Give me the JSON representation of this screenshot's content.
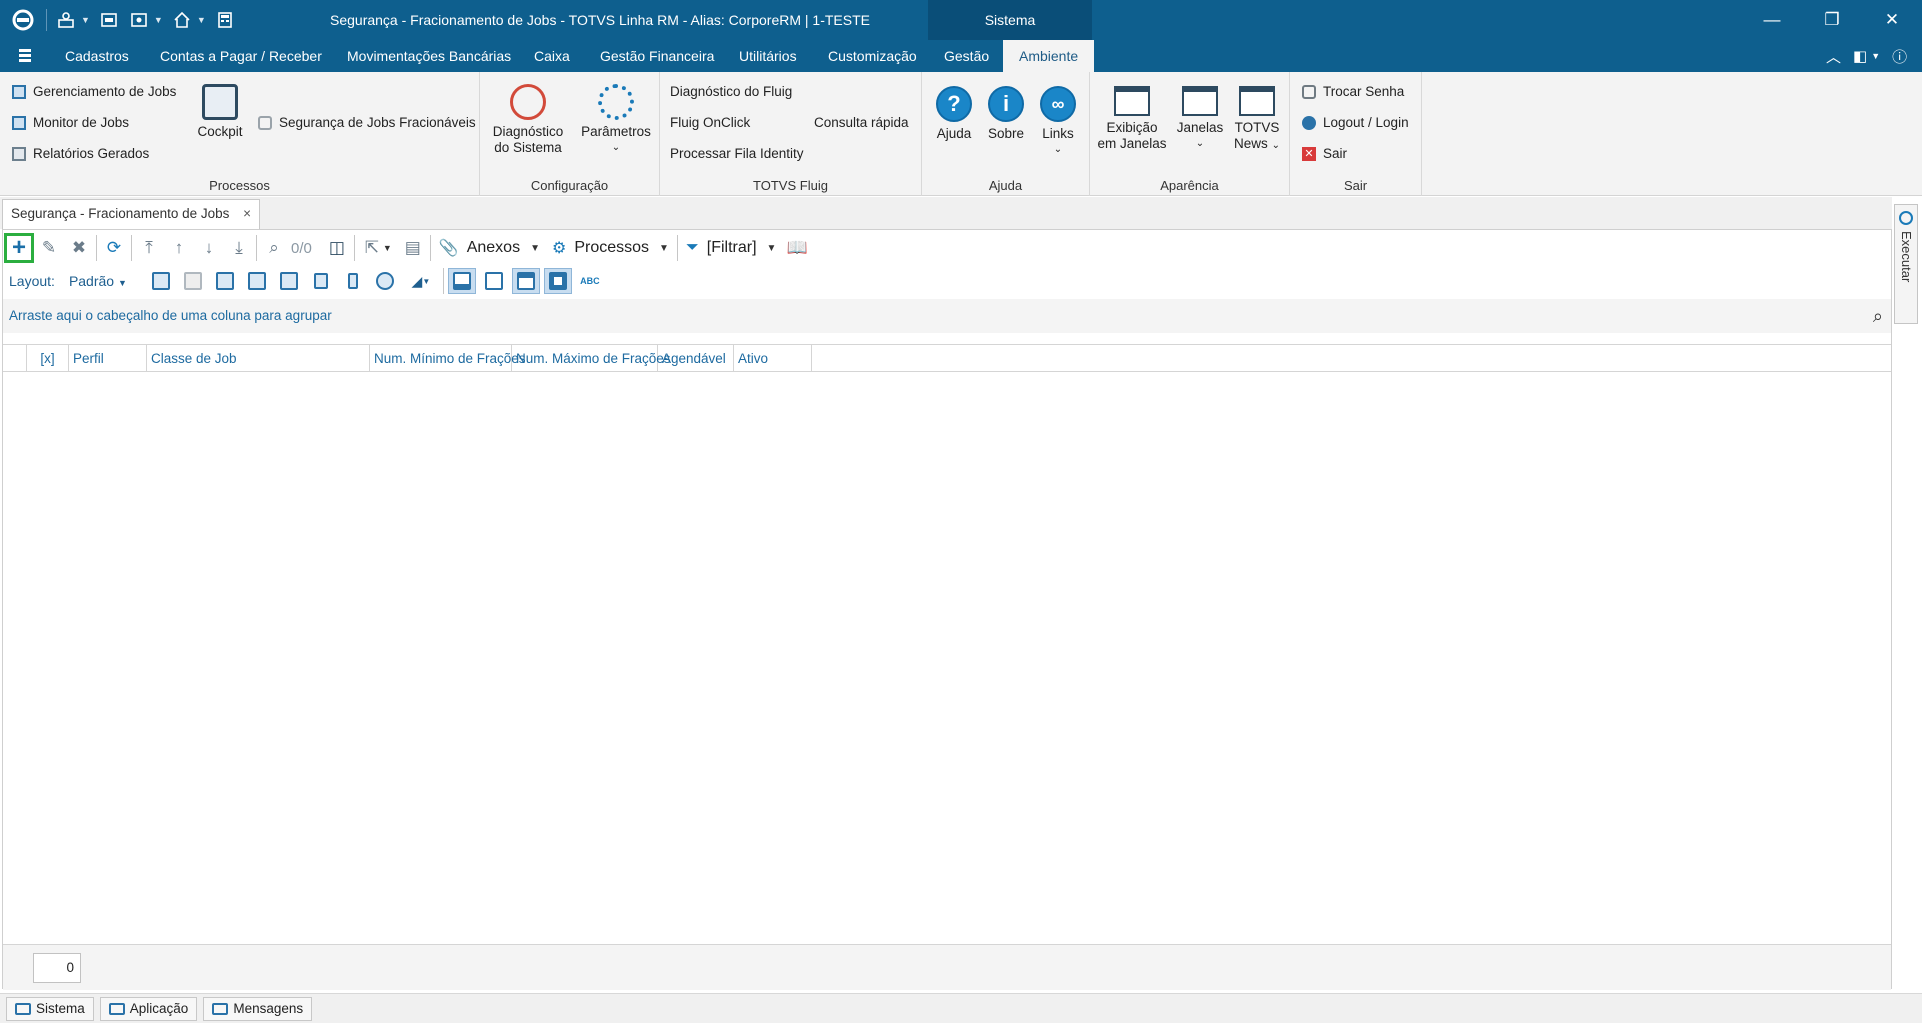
{
  "window": {
    "title": "Segurança - Fracionamento de Jobs - TOTVS Linha RM - Alias: CorporeRM | 1-TESTE",
    "context_tab": "Sistema",
    "minimize": "—",
    "restore": "❐",
    "close": "✕"
  },
  "menu": {
    "items": [
      "Cadastros",
      "Contas a Pagar / Receber",
      "Movimentações Bancárias",
      "Caixa",
      "Gestão Financeira",
      "Utilitários",
      "Customização",
      "Gestão",
      "Ambiente"
    ],
    "active": "Ambiente"
  },
  "ribbon": {
    "processos": {
      "label": "Processos",
      "items": [
        "Gerenciamento de Jobs",
        "Monitor de Jobs",
        "Relatórios Gerados"
      ],
      "cockpit": "Cockpit",
      "seguranca": "Segurança de Jobs Fracionáveis"
    },
    "configuracao": {
      "label": "Configuração",
      "diag_line1": "Diagnóstico",
      "diag_line2": "do Sistema",
      "parametros": "Parâmetros"
    },
    "fluig": {
      "label": "TOTVS Fluig",
      "diag": "Diagnóstico do Fluig",
      "onclick": "Fluig OnClick",
      "consulta": "Consulta rápida",
      "fila": "Processar Fila Identity"
    },
    "ajuda": {
      "label": "Ajuda",
      "ajuda": "Ajuda",
      "sobre": "Sobre",
      "links": "Links"
    },
    "aparencia": {
      "label": "Aparência",
      "exib_line1": "Exibição",
      "exib_line2": "em Janelas",
      "janelas": "Janelas",
      "news_line1": "TOTVS",
      "news_line2": "News"
    },
    "sair": {
      "label": "Sair",
      "trocar": "Trocar Senha",
      "logout": "Logout / Login",
      "sair": "Sair"
    }
  },
  "document_tab": {
    "title": "Segurança - Fracionamento de Jobs",
    "close": "×"
  },
  "toolbar": {
    "record_count": "0/0",
    "anexos": "Anexos",
    "processos": "Processos",
    "filtrar": "[Filtrar]"
  },
  "layout_bar": {
    "label": "Layout:",
    "value": "Padrão"
  },
  "grid": {
    "group_hint": "Arraste aqui o cabeçalho de uma coluna para agrupar",
    "columns": [
      "[x]",
      "Perfil",
      "Classe de Job",
      "Num. Mínimo de Frações",
      "Num. Máximo de Frações",
      "Agendável",
      "Ativo"
    ],
    "rows": [],
    "footer_count": "0"
  },
  "side_panel": {
    "label": "Executar"
  },
  "statusbar": {
    "sistema": "Sistema",
    "aplicacao": "Aplicação",
    "mensagens": "Mensagens"
  },
  "colors": {
    "titlebar": "#0e5f8e",
    "accent": "#1a86c8",
    "highlight": "#2bae3f"
  }
}
